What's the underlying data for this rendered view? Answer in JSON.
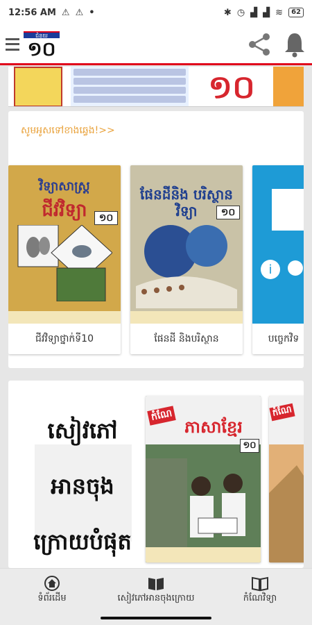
{
  "status_bar": {
    "time": "12:56 AM",
    "battery": "62"
  },
  "app_bar": {
    "logo_text": "ជំនួយ",
    "logo_number": "១០"
  },
  "banner": {
    "number": "១០"
  },
  "section1": {
    "swipe_hint": "សូមអូសទៅខាងឆ្វេង!>>",
    "books": [
      {
        "title": "ជីវវិទ្យាថ្នាក់ទី10",
        "cover_title": "ជីវវិទ្យា",
        "cover_subject": "វិទ្យាសាស្ត្រ",
        "grade": "១០"
      },
      {
        "title": "ផែនដី និងបរិស្ថាន",
        "cover_title": "ផែនដីនិង បរិស្ថានវិទ្យា",
        "grade": "១០"
      },
      {
        "title": "បច្ចេកវិទ"
      }
    ]
  },
  "section2": {
    "reading_text": [
      "សៀវភៅ",
      "អានចុង",
      "ក្រោយបំផុត"
    ],
    "books": [
      {
        "cover_title": "ភាសាខ្មែរ",
        "badge": "កំណែ",
        "grade": "១០"
      },
      {
        "badge": "កំណែ"
      }
    ]
  },
  "bottom_nav": [
    {
      "label": "ទំព័រដើម",
      "icon": "home-icon"
    },
    {
      "label": "សៀវភៅអានចុងក្រោយ",
      "icon": "open-book-icon"
    },
    {
      "label": "កំណែវិទ្យា",
      "icon": "book-icon"
    }
  ],
  "colors": {
    "accent_red": "#e0001a",
    "hint_orange": "#e9a23b",
    "banner_red": "#d7262e"
  }
}
